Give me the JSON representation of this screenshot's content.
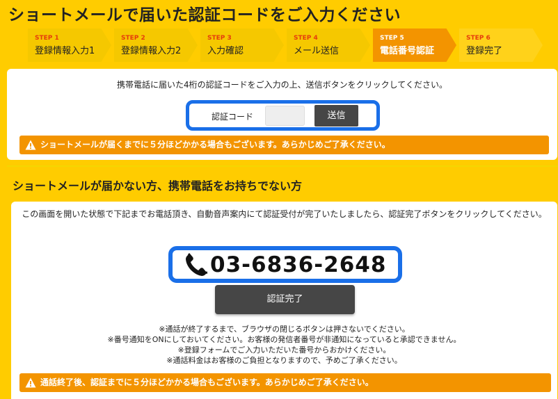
{
  "page": {
    "title": "ショートメールで届いた認証コードをご入力ください"
  },
  "steps": [
    {
      "num": "STEP 1",
      "label": "登録情報入力1",
      "state": "done"
    },
    {
      "num": "STEP 2",
      "label": "登録情報入力2",
      "state": "done"
    },
    {
      "num": "STEP 3",
      "label": "入力確認",
      "state": "done"
    },
    {
      "num": "STEP 4",
      "label": "メール送信",
      "state": "done"
    },
    {
      "num": "STEP 5",
      "label": "電話番号認証",
      "state": "active"
    },
    {
      "num": "STEP 6",
      "label": "登録完了",
      "state": "future"
    }
  ],
  "sms": {
    "instruction": "携帯電話に届いた4桁の認証コードをご入力の上、送信ボタンをクリックしてください。",
    "code_label": "認証コード",
    "code_value": "",
    "code_placeholder": "",
    "send_label": "送信",
    "alert": "ショートメールが届くまでに５分ほどかかる場合もございます。あらかじめご了承ください。"
  },
  "phone_section": {
    "title": "ショートメールが届かない方、携帯電話をお持ちでない方",
    "instruction": "この画面を開いた状態で下記までお電話頂き、自動音声案内にて認証受付が完了いたしましたら、認証完了ボタンをクリックしてください。",
    "phone_number": "03-6836-2648",
    "complete_label": "認証完了",
    "notes": [
      "※通話が終了するまで、ブラウザの閉じるボタンは押さないでください。",
      "※番号通知をONにしておいてください。お客様の発信者番号が非通知になっていると承認できません。",
      "※登録フォームでご入力いただいた番号からおかけください。",
      "※通話料金はお客様のご負担となりますので、予めご了承ください。"
    ],
    "alert": "通話終了後、認証までに５分ほどかかる場合もございます。あらかじめご了承ください。"
  },
  "colors": {
    "background": "#ffcc00",
    "accent_orange": "#f39400",
    "highlight_blue": "#1a6fe8",
    "button_dark": "#464646",
    "step_number_red": "#e53c0c"
  },
  "icons": {
    "warning": "warning-triangle-icon",
    "phone": "phone-handset-icon"
  }
}
